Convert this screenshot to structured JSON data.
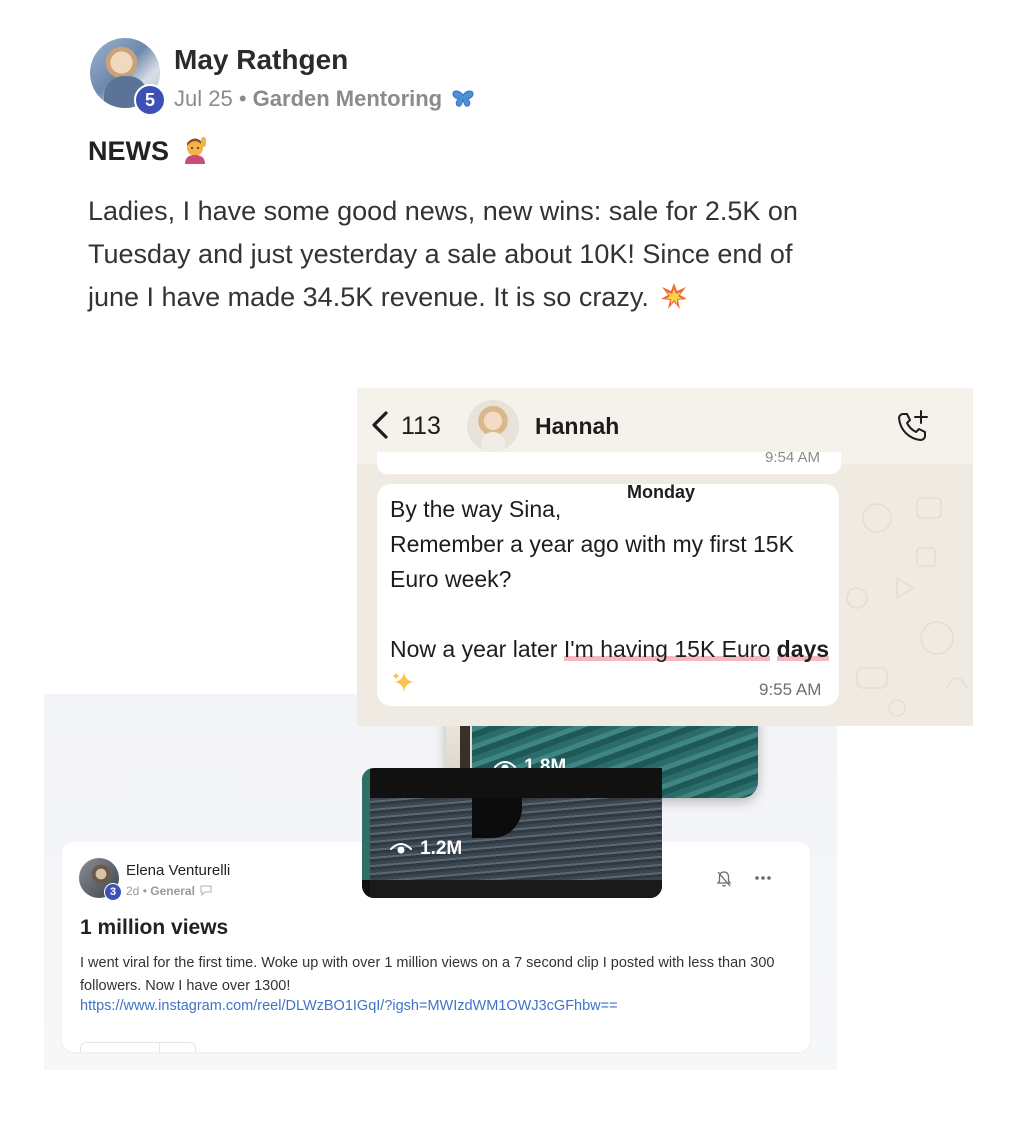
{
  "post1": {
    "author": "May Rathgen",
    "level": "5",
    "date": "Jul 25",
    "separator": "•",
    "group": "Garden Mentoring",
    "group_icon": "butterfly-icon",
    "title": "NEWS",
    "title_icon": "person-raising-hand-icon",
    "body_part1": "Ladies, I have some good news, new wins: sale for 2.5K on Tuesday and just yesterday a sale about 10K! Since end of june I have made ",
    "body_highlight": "34.5K revenue.",
    "body_part2": " It is so crazy.",
    "body_end_icon": "collision-icon",
    "highlight_color": "#c8ebe3"
  },
  "chat": {
    "back_count": "113",
    "contact_name": "Hannah",
    "previous_time": "9:54 AM",
    "day_label": "Monday",
    "message_part1": "By the way Sina,\nRemember a year ago with my first 15K Euro week?\n\nNow a year later ",
    "message_underlined": "I'm having 15K Euro",
    "message_space": " ",
    "message_bold": "days",
    "message_icon": "sparkles-icon",
    "message_time": "9:55 AM",
    "underline_color": "#f3b8c2",
    "background_color": "#efeae2"
  },
  "videos": [
    {
      "views": "1.8M"
    },
    {
      "views": "1.2M"
    }
  ],
  "post2": {
    "author": "Elena Venturelli",
    "level": "3",
    "time": "2d",
    "separator": "•",
    "group": "General",
    "title": "1 million views",
    "body": "I went viral for the first time. Woke up with over 1 million views on a 7 second clip I posted with less than 300 followers. Now I have over 1300!",
    "link": "https://www.instagram.com/reel/DLWzBO1IGqI/?igsh=MWIzdWM1OWJ3cGFhbw==",
    "link_color": "#3f73c8",
    "badge_color": "#3d50b5"
  }
}
